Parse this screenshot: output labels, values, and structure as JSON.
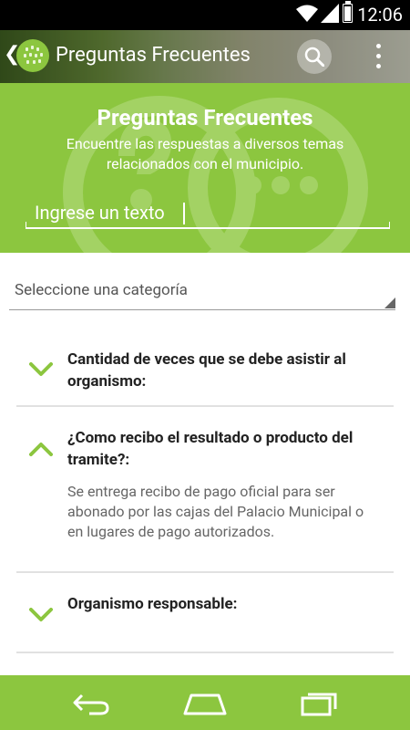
{
  "status_bar": {
    "time": "12:06"
  },
  "action_bar": {
    "title": "Preguntas Frecuentes"
  },
  "hero": {
    "title": "Preguntas Frecuentes",
    "subtitle": "Encuentre las respuestas a diversos temas relacionados con el municipio.",
    "search_placeholder": "Ingrese un texto"
  },
  "category": {
    "placeholder": "Seleccione una categoría"
  },
  "faqs": [
    {
      "question": "Cantidad de veces que se debe asistir al organismo:",
      "answer": "",
      "expanded": false
    },
    {
      "question": "¿Como recibo el resultado o producto del tramite?:",
      "answer": "Se entrega recibo de pago oficial para ser abonado por las cajas del Palacio Municipal o en lugares de pago autorizados.",
      "expanded": true
    },
    {
      "question": "Organismo responsable:",
      "answer": "",
      "expanded": false
    }
  ],
  "colors": {
    "brand_green": "#8cc63f",
    "accent_green": "#8cc63f",
    "text_dark": "#222222",
    "text_muted": "#666666"
  },
  "icons": [
    "back-arrow-icon",
    "app-logo-icon",
    "search-icon",
    "overflow-menu-icon",
    "chevron-down-icon",
    "chevron-up-icon",
    "nav-back-icon",
    "nav-home-icon",
    "nav-recents-icon"
  ]
}
